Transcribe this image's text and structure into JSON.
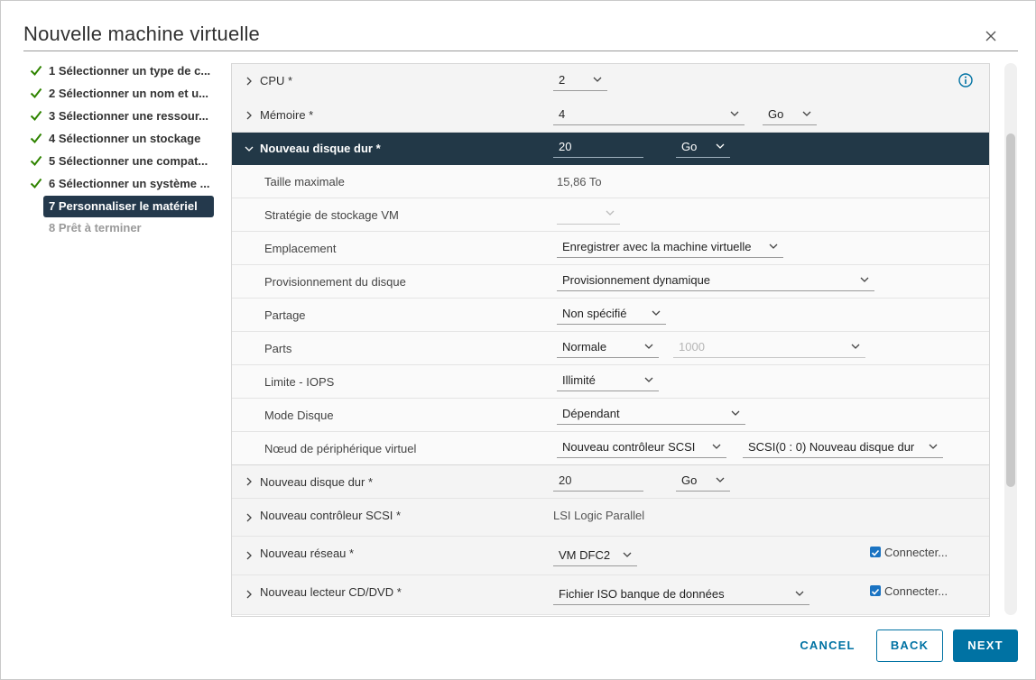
{
  "dialog": {
    "title": "Nouvelle machine virtuelle"
  },
  "steps": [
    {
      "label": "1 Sélectionner un type de c..."
    },
    {
      "label": "2 Sélectionner un nom et u..."
    },
    {
      "label": "3 Sélectionner une ressour..."
    },
    {
      "label": "4 Sélectionner un stockage"
    },
    {
      "label": "5 Sélectionner une compat..."
    },
    {
      "label": "6 Sélectionner un système ..."
    },
    {
      "label": "7 Personnaliser le matériel"
    },
    {
      "label": "8 Prêt à terminer"
    }
  ],
  "hardware": {
    "cpu": {
      "label": "CPU *",
      "value": "2"
    },
    "memory": {
      "label": "Mémoire *",
      "value": "4",
      "unit": "Go"
    },
    "disk_expanded": {
      "label": "Nouveau disque dur *",
      "size": "20",
      "unit": "Go"
    },
    "disk_details": {
      "max_size": {
        "label": "Taille maximale",
        "value": "15,86 To"
      },
      "storage_policy": {
        "label": "Stratégie de stockage VM",
        "value": ""
      },
      "location": {
        "label": "Emplacement",
        "value": "Enregistrer avec la machine virtuelle"
      },
      "provisioning": {
        "label": "Provisionnement du disque",
        "value": "Provisionnement dynamique"
      },
      "sharing": {
        "label": "Partage",
        "value": "Non spécifié"
      },
      "shares": {
        "label": "Parts",
        "value": "Normale",
        "amount": "1000"
      },
      "iops": {
        "label": "Limite - IOPS",
        "value": "Illimité"
      },
      "disk_mode": {
        "label": "Mode Disque",
        "value": "Dépendant"
      },
      "virtual_node": {
        "label": "Nœud de périphérique virtuel",
        "controller": "Nouveau contrôleur SCSI",
        "slot": "SCSI(0 : 0) Nouveau disque dur"
      }
    },
    "disk2": {
      "label": "Nouveau disque dur *",
      "size": "20",
      "unit": "Go"
    },
    "scsi": {
      "label": "Nouveau contrôleur SCSI *",
      "value": "LSI Logic Parallel"
    },
    "network": {
      "label": "Nouveau réseau *",
      "value": "VM DFC2",
      "connect_label": "Connecter..."
    },
    "cdrom": {
      "label": "Nouveau lecteur CD/DVD *",
      "value": "Fichier ISO banque de données",
      "connect_label": "Connecter..."
    }
  },
  "footer": {
    "cancel": "CANCEL",
    "back": "BACK",
    "next": "NEXT"
  },
  "colors": {
    "accent": "#0072a3",
    "selected_row": "#223847",
    "check": "#2f8400",
    "checkbox": "#1a73c2"
  }
}
